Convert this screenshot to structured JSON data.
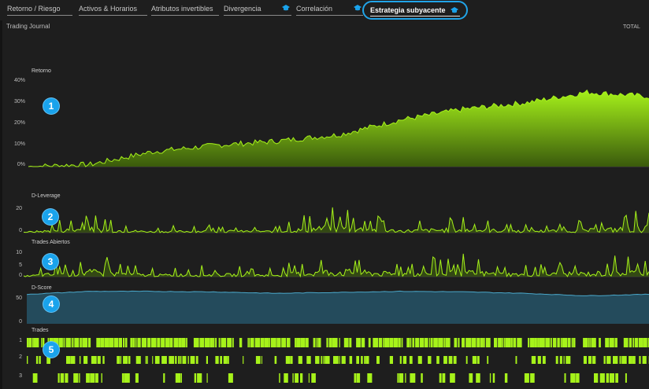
{
  "tabs": [
    {
      "label": "Retorno / Riesgo",
      "cap": false,
      "active": false
    },
    {
      "label": "Activos & Horarios",
      "cap": false,
      "active": false
    },
    {
      "label": "Atributos invertibles",
      "cap": false,
      "active": false
    },
    {
      "label": "Divergencia",
      "cap": true,
      "active": false
    },
    {
      "label": "Correlación",
      "cap": true,
      "active": false
    },
    {
      "label": "Estrategia subyacente",
      "cap": true,
      "active": true
    }
  ],
  "page": {
    "title": "Trading Journal",
    "total_label": "TOTAL"
  },
  "sections": {
    "retorno": {
      "label": "Retorno",
      "ticks": [
        "40%",
        "30%",
        "20%",
        "10%",
        "0%"
      ],
      "badge": "1"
    },
    "leverage": {
      "label": "D-Leverage",
      "ticks": [
        "20",
        "0"
      ],
      "badge": "2"
    },
    "abiertos": {
      "label": "Trades Abiertos",
      "ticks": [
        "10",
        "5",
        "0"
      ],
      "badge": "3"
    },
    "dscore": {
      "label": "D-Score",
      "ticks": [
        "50",
        "0"
      ],
      "badge": "4"
    },
    "trades": {
      "label": "Trades",
      "ticks": [
        "1",
        "2",
        "3"
      ],
      "badge": "5"
    }
  },
  "colors": {
    "lime": "#a6f21a",
    "lime_dark": "#3a5a0c",
    "teal": "#244b5c",
    "teal_line": "#4aa7c9",
    "accent": "#1aa3ec"
  },
  "chart_data": [
    {
      "type": "area",
      "ylabel": "Retorno",
      "ylim": [
        0,
        40
      ],
      "x": [
        0,
        10,
        20,
        30,
        40,
        50,
        60,
        70,
        80,
        90,
        100
      ],
      "values": [
        0,
        1,
        7,
        10,
        12,
        15,
        22,
        27,
        30,
        35,
        33
      ]
    },
    {
      "type": "line",
      "ylabel": "D-Leverage",
      "ylim": [
        0,
        28
      ],
      "x": [
        0,
        10,
        20,
        30,
        40,
        50,
        60,
        70,
        80,
        90,
        100
      ],
      "values": [
        2,
        14,
        4,
        6,
        5,
        20,
        7,
        12,
        6,
        9,
        18
      ]
    },
    {
      "type": "line",
      "ylabel": "Trades Abiertos",
      "ylim": [
        0,
        14
      ],
      "x": [
        0,
        10,
        20,
        30,
        40,
        50,
        60,
        70,
        80,
        90,
        100
      ],
      "values": [
        1,
        9,
        3,
        4,
        3,
        10,
        5,
        8,
        4,
        6,
        9
      ]
    },
    {
      "type": "area",
      "ylabel": "D-Score",
      "ylim": [
        0,
        80
      ],
      "x": [
        0,
        10,
        20,
        30,
        40,
        50,
        60,
        70,
        80,
        90,
        100
      ],
      "values": [
        60,
        66,
        66,
        65,
        62,
        64,
        66,
        65,
        62,
        57,
        60
      ]
    }
  ]
}
